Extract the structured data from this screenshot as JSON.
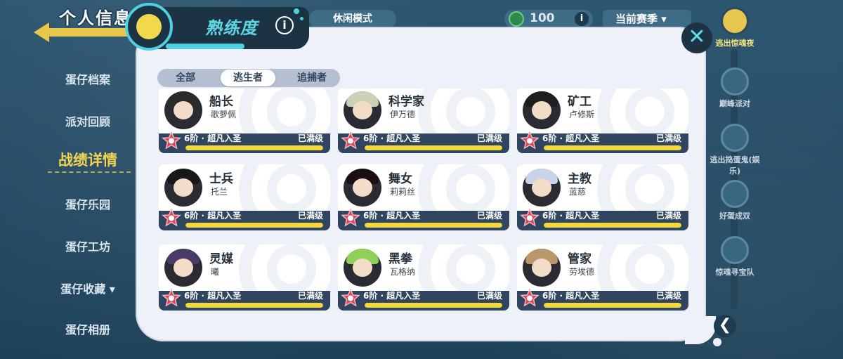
{
  "nav": {
    "title": "个人信息",
    "items": [
      {
        "label": "蛋仔档案"
      },
      {
        "label": "派对回顾"
      },
      {
        "label": "战绩详情"
      },
      {
        "label": "蛋仔乐园"
      },
      {
        "label": "蛋仔工坊"
      },
      {
        "label": "蛋仔收藏"
      },
      {
        "label": "蛋仔相册"
      }
    ]
  },
  "top": {
    "mode": "休闲模式",
    "coins": "100",
    "info": "i",
    "season": "当前赛季"
  },
  "right_strip": [
    {
      "label": "逃出惊魂夜"
    },
    {
      "label": "巅峰派对"
    },
    {
      "label": "逃出捣蛋鬼(娱乐)"
    },
    {
      "label": "好蛋成双"
    },
    {
      "label": "惊魂寻宝队"
    }
  ],
  "panel": {
    "title": "熟练度",
    "info": "i",
    "close": "✕",
    "back": "❮"
  },
  "tabs": [
    {
      "label": "全部"
    },
    {
      "label": "逃生者"
    },
    {
      "label": "追捕者"
    }
  ],
  "cards": [
    {
      "name": "船长",
      "player": "歌萝佩",
      "rank": "6阶 · 超凡入圣",
      "status": "已满级",
      "progress": 1.0,
      "hair": "#2a2a2a"
    },
    {
      "name": "科学家",
      "player": "伊万德",
      "rank": "6阶 · 超凡入圣",
      "status": "已满级",
      "progress": 1.0,
      "hair": "#cbd2b8"
    },
    {
      "name": "矿工",
      "player": "卢修斯",
      "rank": "6阶 · 超凡入圣",
      "status": "已满级",
      "progress": 1.0,
      "hair": "#1e1e1e"
    },
    {
      "name": "士兵",
      "player": "托兰",
      "rank": "6阶 · 超凡入圣",
      "status": "已满级",
      "progress": 1.0,
      "hair": "#181818"
    },
    {
      "name": "舞女",
      "player": "莉莉丝",
      "rank": "6阶 · 超凡入圣",
      "status": "已满级",
      "progress": 1.0,
      "hair": "#1a1014"
    },
    {
      "name": "主教",
      "player": "蓝慈",
      "rank": "6阶 · 超凡入圣",
      "status": "已满级",
      "progress": 1.0,
      "hair": "#c8d4ea"
    },
    {
      "name": "灵媒",
      "player": "曦",
      "rank": "6阶 · 超凡入圣",
      "status": "已满级",
      "progress": 1.0,
      "hair": "#4a3a66"
    },
    {
      "name": "黑拳",
      "player": "瓦格纳",
      "rank": "6阶 · 超凡入圣",
      "status": "已满级",
      "progress": 1.0,
      "hair": "#8fd05a"
    },
    {
      "name": "管家",
      "player": "劳埃德",
      "rank": "6阶 · 超凡入圣",
      "status": "已满级",
      "progress": 1.0,
      "hair": "#b8986a"
    }
  ],
  "colors": {
    "accent": "#5fd6e6",
    "progress": "#f4d63d",
    "nav_active": "#f1d34f"
  }
}
